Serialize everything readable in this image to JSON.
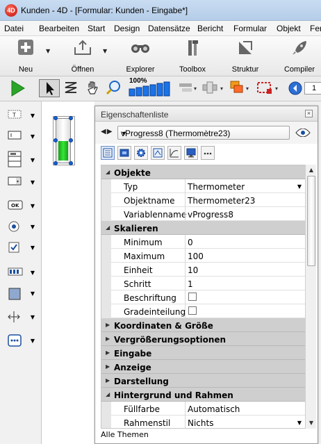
{
  "window": {
    "title": "Kunden - 4D - [Formular: Kunden -  Eingabe*]"
  },
  "menu": [
    "Datei",
    "Bearbeiten",
    "Start",
    "Design",
    "Datensätze",
    "Bericht",
    "Formular",
    "Objekt",
    "Fen"
  ],
  "toolbar": {
    "buttons": [
      {
        "label": "Neu",
        "icon": "plus-icon"
      },
      {
        "label": "Öffnen",
        "icon": "open-icon"
      },
      {
        "label": "Explorer",
        "icon": "binoculars-icon"
      },
      {
        "label": "Toolbox",
        "icon": "tools-icon"
      },
      {
        "label": "Struktur",
        "icon": "structure-icon"
      },
      {
        "label": "Compiler",
        "icon": "rocket-icon"
      }
    ]
  },
  "toolbar2": {
    "zoom_label": "100%",
    "page_field": "1"
  },
  "property_list": {
    "title": "Eigenschaftenliste",
    "selected_object": "vProgress8 (Thermomètre23)",
    "groups": {
      "objekte": "Objekte",
      "skalieren": "Skalieren",
      "koordinaten": "Koordinaten & Größe",
      "vergroesserung": "Vergrößerungsoptionen",
      "eingabe": "Eingabe",
      "anzeige": "Anzeige",
      "darstellung": "Darstellung",
      "hintergrund": "Hintergrund und Rahmen"
    },
    "rows": {
      "typ": {
        "label": "Typ",
        "value": "Thermometer"
      },
      "objektname": {
        "label": "Objektname",
        "value": "Thermometer23"
      },
      "variablenname": {
        "label": "Variablenname",
        "value": "vProgress8"
      },
      "minimum": {
        "label": "Minimum",
        "value": "0"
      },
      "maximum": {
        "label": "Maximum",
        "value": "100"
      },
      "einheit": {
        "label": "Einheit",
        "value": "10"
      },
      "schritt": {
        "label": "Schritt",
        "value": "1"
      },
      "beschriftung": {
        "label": "Beschriftung",
        "checked": false
      },
      "gradeinteilung": {
        "label": "Gradeinteilung",
        "checked": false
      },
      "fuellfarbe": {
        "label": "Füllfarbe",
        "value": "Automatisch"
      },
      "rahmenstil": {
        "label": "Rahmenstil",
        "value": "Nichts"
      }
    },
    "footer": "Alle Themen"
  }
}
